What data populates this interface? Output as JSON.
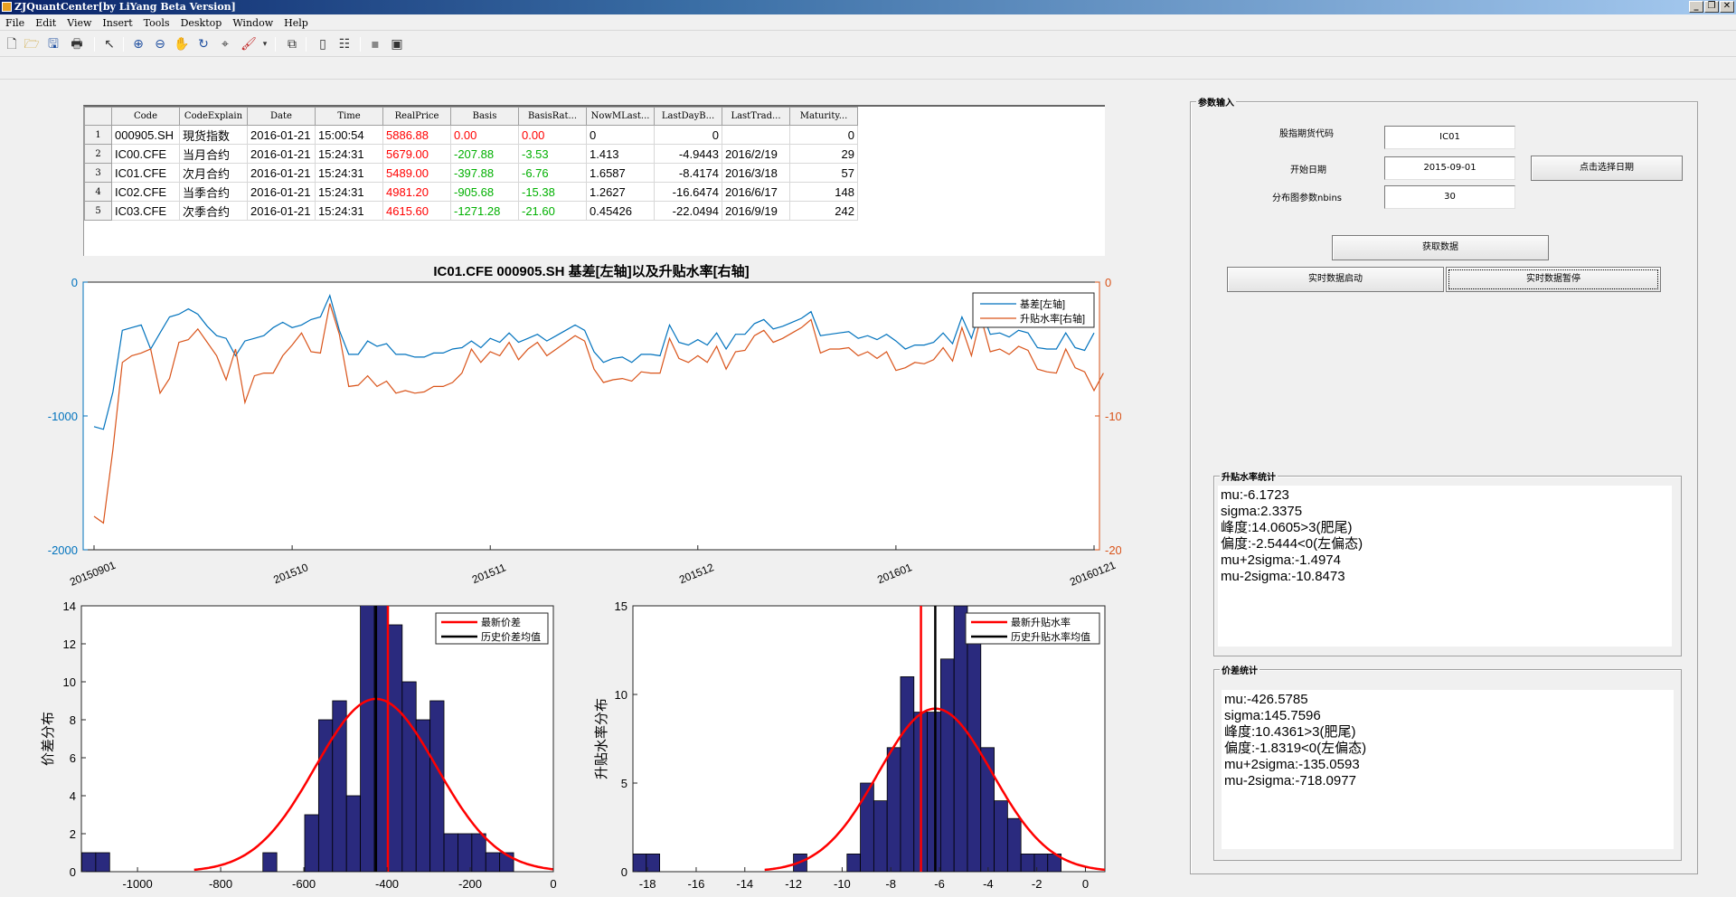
{
  "window": {
    "title": "ZJQuantCenter[by LiYang Beta Version]",
    "minimize": "_",
    "restore": "❐",
    "close": "✕"
  },
  "menu": [
    "File",
    "Edit",
    "View",
    "Insert",
    "Tools",
    "Desktop",
    "Window",
    "Help"
  ],
  "table": {
    "columns": [
      "Code",
      "CodeExplain",
      "Date",
      "Time",
      "RealPrice",
      "Basis",
      "BasisRat...",
      "NowMLast...",
      "LastDayB...",
      "LastTrad...",
      "Maturity..."
    ],
    "rows": [
      {
        "n": "1",
        "code": "000905.SH",
        "explain": "現货指数",
        "date": "2016-01-21",
        "time": "15:00:54",
        "price": "5886.88",
        "basis": "0.00",
        "ratio": "0.00",
        "nowm": "0",
        "lastday": "0",
        "lasttrad": "",
        "maturity": "0"
      },
      {
        "n": "2",
        "code": "IC00.CFE",
        "explain": "当月合约",
        "date": "2016-01-21",
        "time": "15:24:31",
        "price": "5679.00",
        "basis": "-207.88",
        "ratio": "-3.53",
        "nowm": "1.413",
        "lastday": "-4.9443",
        "lasttrad": "2016/2/19",
        "maturity": "29"
      },
      {
        "n": "3",
        "code": "IC01.CFE",
        "explain": "次月合约",
        "date": "2016-01-21",
        "time": "15:24:31",
        "price": "5489.00",
        "basis": "-397.88",
        "ratio": "-6.76",
        "nowm": "1.6587",
        "lastday": "-8.4174",
        "lasttrad": "2016/3/18",
        "maturity": "57"
      },
      {
        "n": "4",
        "code": "IC02.CFE",
        "explain": "当季合约",
        "date": "2016-01-21",
        "time": "15:24:31",
        "price": "4981.20",
        "basis": "-905.68",
        "ratio": "-15.38",
        "nowm": "1.2627",
        "lastday": "-16.6474",
        "lasttrad": "2016/6/17",
        "maturity": "148"
      },
      {
        "n": "5",
        "code": "IC03.CFE",
        "explain": "次季合约",
        "date": "2016-01-21",
        "time": "15:24:31",
        "price": "4615.60",
        "basis": "-1271.28",
        "ratio": "-21.60",
        "nowm": "0.45426",
        "lastday": "-22.0494",
        "lasttrad": "2016/9/19",
        "maturity": "242"
      }
    ]
  },
  "params": {
    "title": "参数输入",
    "code_label": "股指期货代码",
    "code_value": "IC01",
    "start_label": "开始日期",
    "start_value": "2015-09-01",
    "pick_date_button": "点击选择日期",
    "nbins_label": "分布图参数nbins",
    "nbins_value": "30",
    "fetch_button": "获取数据",
    "realtime_start_button": "实时数据启动",
    "realtime_pause_button": "实时数据暂停"
  },
  "stats_ratio": {
    "title": "升贴水率统计",
    "lines": [
      "mu:-6.1723",
      "sigma:2.3375",
      "峰度:14.0605>3(肥尾)",
      "偏度:-2.5444<0(左偏态)",
      "mu+2sigma:-1.4974",
      "mu-2sigma:-10.8473"
    ]
  },
  "stats_basis": {
    "title": "价差统计",
    "lines": [
      "mu:-426.5785",
      "sigma:145.7596",
      "峰度:10.4361>3(肥尾)",
      "偏度:-1.8319<0(左偏态)",
      "mu+2sigma:-135.0593",
      "mu-2sigma:-718.0977"
    ]
  },
  "colors": {
    "basis_line": "#0072bd",
    "ratio_line": "#d95319",
    "hist_bar": "#2a2a7e",
    "fit_red": "#ff0000",
    "mean_black": "#000000"
  },
  "chart_data": [
    {
      "type": "line",
      "title": "IC01.CFE 000905.SH 基差[左轴]以及升贴水率[右轴]",
      "x_ticks": [
        "20150901",
        "201510",
        "201511",
        "201512",
        "201601",
        "20160121"
      ],
      "y_left_ticks": [
        "0",
        "-1000",
        "-2000"
      ],
      "ylim_left": [
        -2000,
        0
      ],
      "y_right_ticks": [
        "0",
        "-10",
        "-20"
      ],
      "ylim_right": [
        -20,
        0
      ],
      "legend": "top-right",
      "series": [
        {
          "name": "基差[左轴]",
          "axis": "left",
          "values": [
            -1080,
            -1100,
            -820,
            -360,
            -340,
            -320,
            -500,
            -380,
            -260,
            -240,
            -200,
            -240,
            -330,
            -400,
            -420,
            -550,
            -440,
            -420,
            -400,
            -340,
            -300,
            -340,
            -320,
            -280,
            -260,
            -100,
            -360,
            -540,
            -540,
            -440,
            -480,
            -460,
            -540,
            -540,
            -560,
            -560,
            -530,
            -530,
            -500,
            -490,
            -440,
            -490,
            -420,
            -450,
            -380,
            -450,
            -420,
            -390,
            -440,
            -400,
            -360,
            -320,
            -360,
            -520,
            -600,
            -570,
            -560,
            -600,
            -540,
            -540,
            -550,
            -320,
            -450,
            -470,
            -430,
            -470,
            -380,
            -500,
            -390,
            -390,
            -310,
            -280,
            -350,
            -330,
            -300,
            -270,
            -220,
            -400,
            -390,
            -380,
            -370,
            -420,
            -400,
            -430,
            -390,
            -440,
            -500,
            -470,
            -470,
            -450,
            -380,
            -460,
            -260,
            -420,
            -200,
            -390,
            -380,
            -410,
            -360,
            -380,
            -490,
            -500,
            -500,
            -380,
            -490,
            -510,
            -380
          ]
        },
        {
          "name": "升贴水率[右轴]",
          "axis": "right",
          "values": [
            -17.5,
            -18,
            -12.5,
            -6,
            -5.5,
            -5.3,
            -5,
            -8.3,
            -7.2,
            -4.5,
            -4.3,
            -3.5,
            -4.5,
            -5.5,
            -7.3,
            -5,
            -9,
            -7,
            -6.8,
            -6.8,
            -5.5,
            -4.7,
            -3.8,
            -5.2,
            -5.3,
            -1.6,
            -3.9,
            -7.8,
            -7.7,
            -7,
            -7.8,
            -7.4,
            -8.3,
            -8.1,
            -8.3,
            -8.2,
            -7.8,
            -7.8,
            -7.5,
            -6.8,
            -5,
            -6,
            -5.2,
            -5.5,
            -4.5,
            -5.8,
            -5,
            -4.5,
            -5.5,
            -5,
            -4.5,
            -4,
            -4.4,
            -6.5,
            -7.5,
            -7.3,
            -7.2,
            -7.4,
            -6.7,
            -6.8,
            -6.8,
            -4.2,
            -5.7,
            -6,
            -5.5,
            -6,
            -4.8,
            -6.5,
            -5.2,
            -5.1,
            -4,
            -3.6,
            -4.5,
            -4.2,
            -3.8,
            -3.4,
            -2.8,
            -5.3,
            -5,
            -5,
            -4.9,
            -5.5,
            -5.2,
            -5.7,
            -5.2,
            -6.6,
            -6.4,
            -6,
            -6.1,
            -5.8,
            -4.9,
            -5.9,
            -3.4,
            -5.5,
            -2.6,
            -5.2,
            -5,
            -5.4,
            -4.8,
            -5.1,
            -6.5,
            -6.7,
            -6.8,
            -5,
            -6.4,
            -6.7,
            -8.1,
            -6.8
          ]
        }
      ]
    },
    {
      "type": "bar",
      "title": "",
      "ylabel": "价差分布",
      "x_ticks": [
        "-1000",
        "-800",
        "-600",
        "-400",
        "-200",
        "0"
      ],
      "xlim": [
        -1135,
        0
      ],
      "y_ticks": [
        "0",
        "2",
        "4",
        "6",
        "8",
        "10",
        "12",
        "14"
      ],
      "ylim": [
        0,
        14
      ],
      "legend": [
        "最新价差",
        "历史价差均值"
      ],
      "bin_width": 33.5,
      "bin_left_edges": [
        -1134,
        -1100.5,
        -1067,
        -1033.5,
        -1000,
        -966.5,
        -933,
        -899.5,
        -866,
        -832.5,
        -799,
        -765.5,
        -732,
        -698.5,
        -665,
        -631.5,
        -598,
        -564.5,
        -531,
        -497.5,
        -464,
        -430.5,
        -397,
        -363.5,
        -330,
        -296.5,
        -263,
        -229.5,
        -196,
        -162.5,
        -129,
        -95.5,
        -62,
        -28.5
      ],
      "counts": [
        1,
        1,
        0,
        0,
        0,
        0,
        0,
        0,
        0,
        0,
        0,
        0,
        0,
        1,
        0,
        0,
        3,
        8,
        9,
        4,
        15,
        15,
        13,
        10,
        8,
        9,
        2,
        2,
        2,
        1,
        1,
        0,
        0,
        0
      ],
      "latest": -397.88,
      "mean": -426.5785,
      "fit": {
        "mu": -426.5785,
        "sigma": 145.7596,
        "peak": 9.1
      }
    },
    {
      "type": "bar",
      "title": "",
      "ylabel": "升贴水率分布",
      "x_ticks": [
        "-18",
        "-16",
        "-14",
        "-12",
        "-10",
        "-8",
        "-6",
        "-4",
        "-2",
        "0"
      ],
      "xlim": [
        -18.6,
        0.8
      ],
      "y_ticks": [
        "0",
        "5",
        "10",
        "15"
      ],
      "ylim": [
        0,
        15
      ],
      "legend": [
        "最新升贴水率",
        "历史升贴水率均值"
      ],
      "bin_width": 0.55,
      "bin_left_edges": [
        -18.6,
        -18.05,
        -17.5,
        -16.95,
        -16.4,
        -15.85,
        -15.3,
        -14.75,
        -14.2,
        -13.65,
        -13.1,
        -12.55,
        -12.0,
        -11.45,
        -10.9,
        -10.35,
        -9.8,
        -9.25,
        -8.7,
        -8.15,
        -7.6,
        -7.05,
        -6.5,
        -5.95,
        -5.4,
        -4.85,
        -4.3,
        -3.75,
        -3.2,
        -2.65,
        -2.1,
        -1.55,
        -1.0
      ],
      "counts": [
        1,
        1,
        0,
        0,
        0,
        0,
        0,
        0,
        0,
        0,
        0,
        0,
        1,
        0,
        0,
        0,
        1,
        5,
        4,
        7,
        11,
        9,
        9,
        12,
        15,
        13,
        7,
        4,
        3,
        1,
        1,
        1,
        0
      ],
      "latest": -6.76,
      "mean": -6.1723,
      "fit": {
        "mu": -6.1723,
        "sigma": 2.3375,
        "peak": 9.2
      }
    }
  ]
}
